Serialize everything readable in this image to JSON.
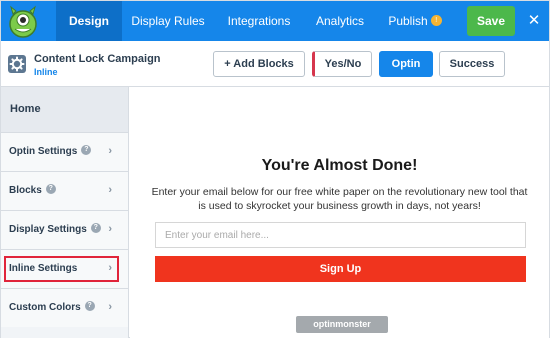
{
  "topbar": {
    "logo_icon": "optinmonster-logo",
    "tabs": [
      {
        "label": "Design",
        "active": true
      },
      {
        "label": "Display Rules",
        "active": false
      },
      {
        "label": "Integrations",
        "active": false
      },
      {
        "label": "Analytics",
        "active": false
      },
      {
        "label": "Publish",
        "active": false
      }
    ],
    "publish_badge": "!",
    "save_label": "Save",
    "close_label": "✕"
  },
  "campaign": {
    "title": "Content Lock Campaign",
    "type": "Inline"
  },
  "views": {
    "add_blocks_label": "+ Add Blocks",
    "yesno_label": "Yes/No",
    "optin_label": "Optin",
    "success_label": "Success"
  },
  "sidebar": {
    "home_label": "Home",
    "items": [
      {
        "label": "Optin Settings",
        "help": true
      },
      {
        "label": "Blocks",
        "help": true
      },
      {
        "label": "Display Settings",
        "help": true
      },
      {
        "label": "Inline Settings",
        "help": false
      },
      {
        "label": "Custom Colors",
        "help": true
      }
    ],
    "help_glyph": "?",
    "chevron_glyph": "›"
  },
  "optin": {
    "headline": "You're Almost Done!",
    "body": "Enter your email below for our free white paper on the revolutionary new tool that is used to skyrocket your business growth in days, not years!",
    "email_placeholder": "Enter your email here...",
    "button_label": "Sign Up",
    "branding": "optinmonster"
  },
  "colors": {
    "topbar": "#1586ea",
    "active_tab": "#0d6fc8",
    "save_green": "#4cb84b",
    "signup_red": "#f0341e",
    "highlight_red": "#e0243a"
  }
}
